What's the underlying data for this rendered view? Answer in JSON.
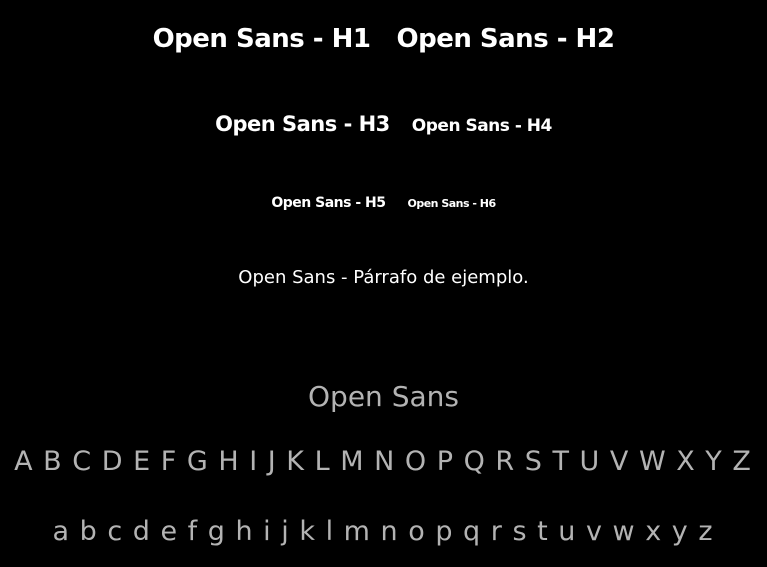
{
  "headings": {
    "h1": "Open Sans - H1",
    "h2": "Open Sans - H2",
    "h3": "Open Sans - H3",
    "h4": "Open Sans - H4",
    "h5": "Open Sans - H5",
    "h6": "Open Sans - H6"
  },
  "paragraph": "Open Sans - Párrafo de ejemplo.",
  "specimen": {
    "title": "Open Sans",
    "uppercase": "A B C D E F G H I J K L M N O P Q R S T U V W X Y Z",
    "lowercase": "a b c d e f g h i j k l m n o p q r s t u v w x y z"
  },
  "colors": {
    "background": "#000000",
    "heading_text": "#ffffff",
    "specimen_text": "#b3b3b3"
  }
}
